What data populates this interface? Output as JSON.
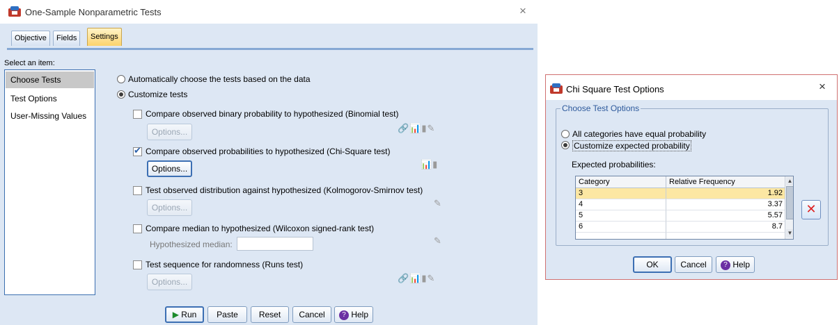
{
  "main_window": {
    "title": "One-Sample Nonparametric Tests",
    "close_glyph": "×",
    "tabs": [
      {
        "label": "Objective",
        "active": false
      },
      {
        "label": "Fields",
        "active": false
      },
      {
        "label": "Settings",
        "active": true
      }
    ],
    "select_label": "Select an item:",
    "items": [
      {
        "label": "Choose Tests",
        "selected": true
      },
      {
        "label": "Test Options",
        "selected": false
      },
      {
        "label": "User-Missing Values",
        "selected": false
      }
    ],
    "auto_radio_label": "Automatically choose the tests based on the data",
    "custom_radio_label": "Customize tests",
    "tests": [
      {
        "label": "Compare observed binary probability to hypothesized (Binomial test)",
        "checked": false,
        "options_label": "Options...",
        "options_enabled": false,
        "icons": "🔗📊▮✎"
      },
      {
        "label": "Compare observed probabilities to hypothesized (Chi-Square test)",
        "checked": true,
        "options_label": "Options...",
        "options_enabled": true,
        "icons": "📊▮"
      },
      {
        "label": "Test observed distribution against hypothesized (Kolmogorov-Smirnov test)",
        "checked": false,
        "options_label": "Options...",
        "options_enabled": false,
        "icons": "✎"
      },
      {
        "label": "Compare median to hypothesized (Wilcoxon signed-rank test)",
        "checked": false,
        "hypothesized_label": "Hypothesized median:",
        "hypothesized_value": "",
        "icons": "✎"
      },
      {
        "label": "Test sequence for randomness (Runs test)",
        "checked": false,
        "options_label": "Options...",
        "options_enabled": false,
        "icons": "🔗📊▮✎"
      }
    ],
    "buttons": {
      "run": "Run",
      "paste": "Paste",
      "reset": "Reset",
      "cancel": "Cancel",
      "help": "Help"
    }
  },
  "chi_dialog": {
    "title": "Chi Square Test Options",
    "close_glyph": "×",
    "group_title": "Choose Test Options",
    "equal_label": "All categories have equal probability",
    "custom_label": "Customize expected probability",
    "expected_label": "Expected probabilities:",
    "columns": [
      "Category",
      "Relative Frequency"
    ],
    "rows": [
      {
        "category": "3",
        "frequency": "1.92"
      },
      {
        "category": "4",
        "frequency": "3.37"
      },
      {
        "category": "5",
        "frequency": "5.57"
      },
      {
        "category": "6",
        "frequency": "8.7"
      }
    ],
    "buttons": {
      "ok": "OK",
      "cancel": "Cancel",
      "help": "Help"
    }
  }
}
